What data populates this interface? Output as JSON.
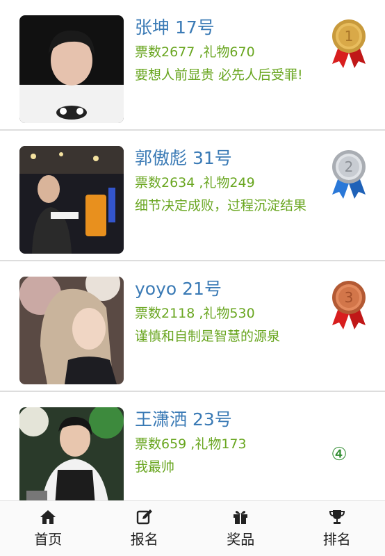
{
  "contestants": [
    {
      "name_line": "张坤 17号",
      "stats": "票数2677 ,礼物670",
      "motto": "要想人前显贵 必先人后受罪!",
      "rank": "1"
    },
    {
      "name_line": "郭傲彪 31号",
      "stats": "票数2634 ,礼物249",
      "motto": "细节决定成败，过程沉淀结果",
      "rank": "2"
    },
    {
      "name_line": "yoyo 21号",
      "stats": "票数2118 ,礼物530",
      "motto": "谨慎和自制是智慧的源泉",
      "rank": "3"
    },
    {
      "name_line": "王潇洒 23号",
      "stats": "票数659 ,礼物173",
      "motto": "我最帅",
      "rank": "4"
    }
  ],
  "rank_badge_4": "④",
  "tabbar": {
    "items": [
      {
        "label": "首页",
        "icon": "home-icon"
      },
      {
        "label": "报名",
        "icon": "edit-icon"
      },
      {
        "label": "奖品",
        "icon": "gift-icon"
      },
      {
        "label": "排名",
        "icon": "trophy-icon"
      }
    ]
  },
  "colors": {
    "name": "#3a7ab5",
    "text_green": "#69a620",
    "gold": "#d4a24a",
    "silver": "#c8ccd2",
    "bronze": "#d2764a",
    "ribbon_red": "#d81e1e",
    "ribbon_blue": "#2a78d8"
  }
}
